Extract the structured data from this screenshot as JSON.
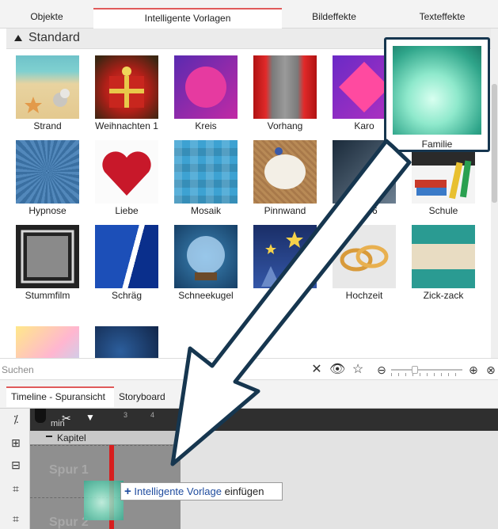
{
  "tabs": [
    {
      "label": "Objekte"
    },
    {
      "label": "Intelligente Vorlagen"
    },
    {
      "label": "Bildeffekte"
    },
    {
      "label": "Texteffekte"
    }
  ],
  "section": {
    "label": "Standard"
  },
  "templates": [
    {
      "label": "Strand"
    },
    {
      "label": "Weihnachten 1"
    },
    {
      "label": "Kreis"
    },
    {
      "label": "Vorhang"
    },
    {
      "label": "Karo"
    },
    {
      "label": "Familie"
    },
    {
      "label": "Hypnose"
    },
    {
      "label": "Liebe"
    },
    {
      "label": "Mosaik"
    },
    {
      "label": "Pinnwand"
    },
    {
      "label": "ute 66"
    },
    {
      "label": "Schule"
    },
    {
      "label": "Stummfilm"
    },
    {
      "label": "Schräg"
    },
    {
      "label": "Schneekugel"
    },
    {
      "label": "St"
    },
    {
      "label": "Hochzeit"
    },
    {
      "label": "Zick-zack"
    }
  ],
  "search": {
    "placeholder": "Suchen"
  },
  "timeline": {
    "tabs": [
      {
        "label": "Timeline - Spuransicht"
      },
      {
        "label": "Storyboard"
      }
    ],
    "ruler": {
      "unit": "min",
      "marks": [
        "1",
        "3",
        "4"
      ]
    },
    "chapter": "Kapitel",
    "tracks": [
      "Spur 1",
      "Spur 2"
    ]
  },
  "tooltip": {
    "prefix": "Intelligente Vorlage",
    "suffix": " einfügen"
  },
  "colors": {
    "accent": "#e05a5a",
    "highlight_border": "#16364f",
    "tooltip_blue": "#1e4b9e",
    "timeline_marker": "#d81e1e"
  }
}
